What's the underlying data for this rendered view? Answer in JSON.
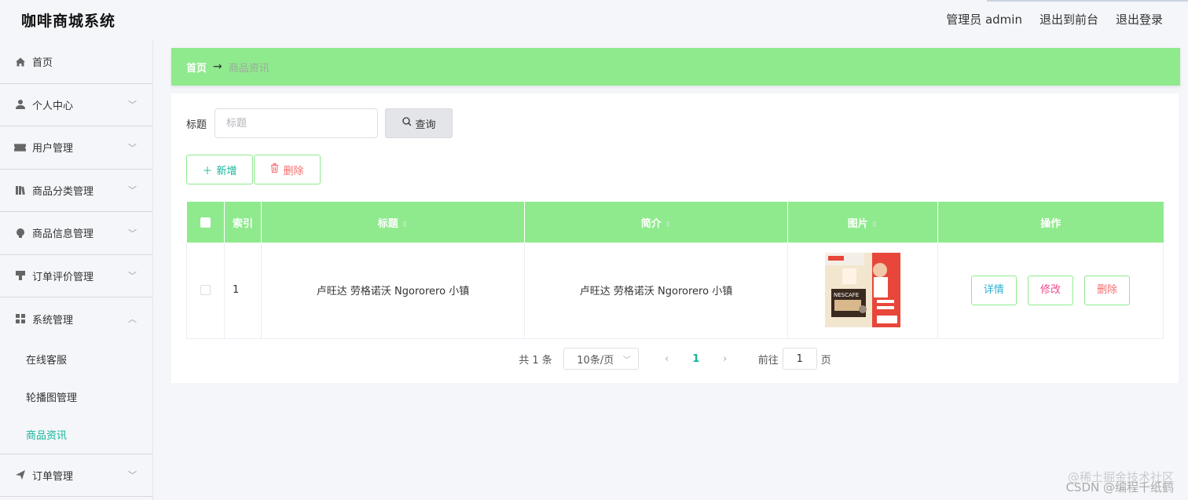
{
  "app": {
    "title": "咖啡商城系统"
  },
  "header": {
    "admin_label": "管理员 admin",
    "to_front": "退出到前台",
    "logout": "退出登录"
  },
  "sidebar": {
    "items": [
      {
        "label": "首页",
        "icon": "home-icon"
      },
      {
        "label": "个人中心",
        "icon": "user-icon"
      },
      {
        "label": "用户管理",
        "icon": "ticket-icon"
      },
      {
        "label": "商品分类管理",
        "icon": "books-icon"
      },
      {
        "label": "商品信息管理",
        "icon": "bulb-icon"
      },
      {
        "label": "订单评价管理",
        "icon": "stamp-icon"
      },
      {
        "label": "系统管理",
        "icon": "grid-icon"
      }
    ],
    "sub_items": [
      {
        "label": "在线客服"
      },
      {
        "label": "轮播图管理"
      },
      {
        "label": "商品资讯"
      }
    ],
    "last_item": {
      "label": "订单管理",
      "icon": "send-icon"
    }
  },
  "breadcrumb": {
    "home": "首页",
    "arrow": "→",
    "current": "商品资讯"
  },
  "search": {
    "label": "标题",
    "placeholder": "标题",
    "button": "查询"
  },
  "actions": {
    "add": "新增",
    "delete": "删除"
  },
  "table": {
    "headers": {
      "index": "索引",
      "title": "标题",
      "intro": "简介",
      "image": "图片",
      "ops": "操作"
    },
    "rows": [
      {
        "index": "1",
        "title": "卢旺达 劳格诺沃 Ngororero 小镇",
        "intro": "卢旺达 劳格诺沃 Ngororero 小镇",
        "image_text": "NESCAFE",
        "detail": "详情",
        "edit": "修改",
        "delete": "删除"
      }
    ]
  },
  "pagination": {
    "total": "共 1 条",
    "page_size": "10条/页",
    "current_page": "1",
    "goto_label": "前往",
    "goto_value": "1",
    "page_suffix": "页"
  },
  "watermark": {
    "line1": "@稀土掘金技术社区",
    "line2": "CSDN @编程千纸鹤"
  },
  "colors": {
    "accent": "#8fea8d",
    "active": "#13b59a",
    "danger": "#f56c6c"
  }
}
